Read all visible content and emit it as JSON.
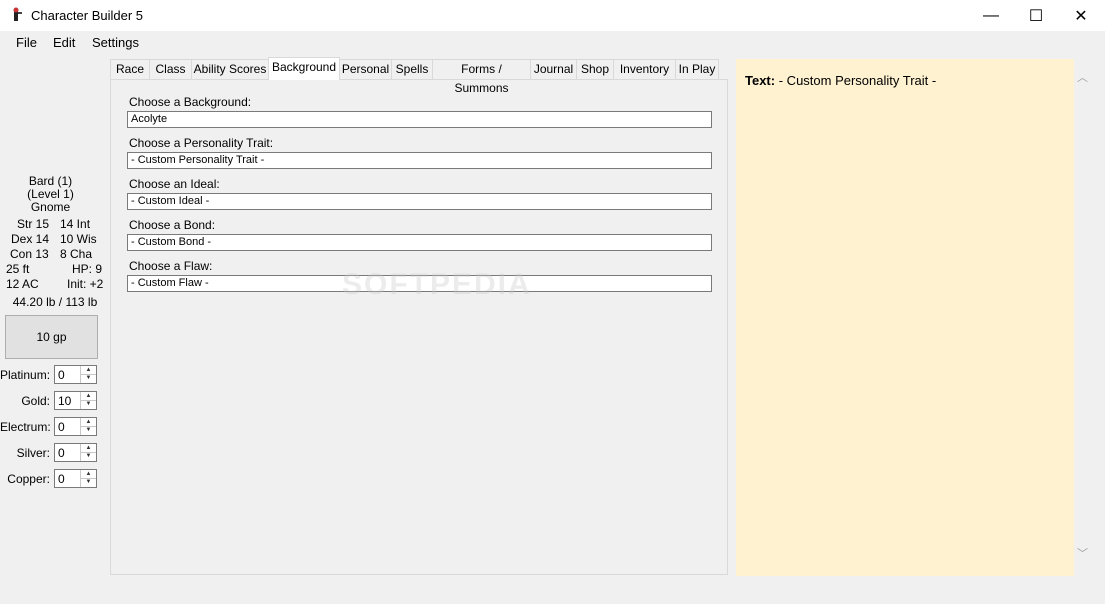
{
  "window": {
    "title": "Character Builder 5",
    "minimize": "—",
    "maximize": "☐",
    "close": "✕"
  },
  "menu": [
    "File",
    "Edit",
    "Settings"
  ],
  "character": {
    "class_line": "Bard (1)",
    "level_line": "(Level 1)",
    "race": "Gnome",
    "str": "Str 15",
    "int": "14 Int",
    "dex": "Dex 14",
    "wis": "10 Wis",
    "con": "Con 13",
    "cha": "8 Cha",
    "speed": "25 ft",
    "hp": "HP: 9",
    "ac": "12 AC",
    "init": "Init: +2",
    "weight": "44.20 lb / 113 lb",
    "gold_total": "10 gp"
  },
  "coins": [
    {
      "label": "Platinum:",
      "value": "0"
    },
    {
      "label": "Gold:",
      "value": "10"
    },
    {
      "label": "Electrum:",
      "value": "0"
    },
    {
      "label": "Silver:",
      "value": "0"
    },
    {
      "label": "Copper:",
      "value": "0"
    }
  ],
  "tabs": [
    "Race",
    "Class",
    "Ability Scores",
    "Background",
    "Personal",
    "Spells",
    "Forms / Summons",
    "Journal",
    "Shop",
    "Inventory",
    "In Play"
  ],
  "active_tab": "Background",
  "fields": [
    {
      "label": "Choose a Background:",
      "value": "Acolyte"
    },
    {
      "label": "Choose a Personality Trait:",
      "value": "- Custom Personality Trait -"
    },
    {
      "label": "Choose an Ideal:",
      "value": "- Custom Ideal -"
    },
    {
      "label": "Choose a Bond:",
      "value": "- Custom Bond -"
    },
    {
      "label": "Choose a Flaw:",
      "value": "- Custom Flaw -"
    }
  ],
  "text_panel": {
    "label": "Text:",
    "value": "- Custom Personality Trait -"
  },
  "watermark": "SOFTPEDIA"
}
